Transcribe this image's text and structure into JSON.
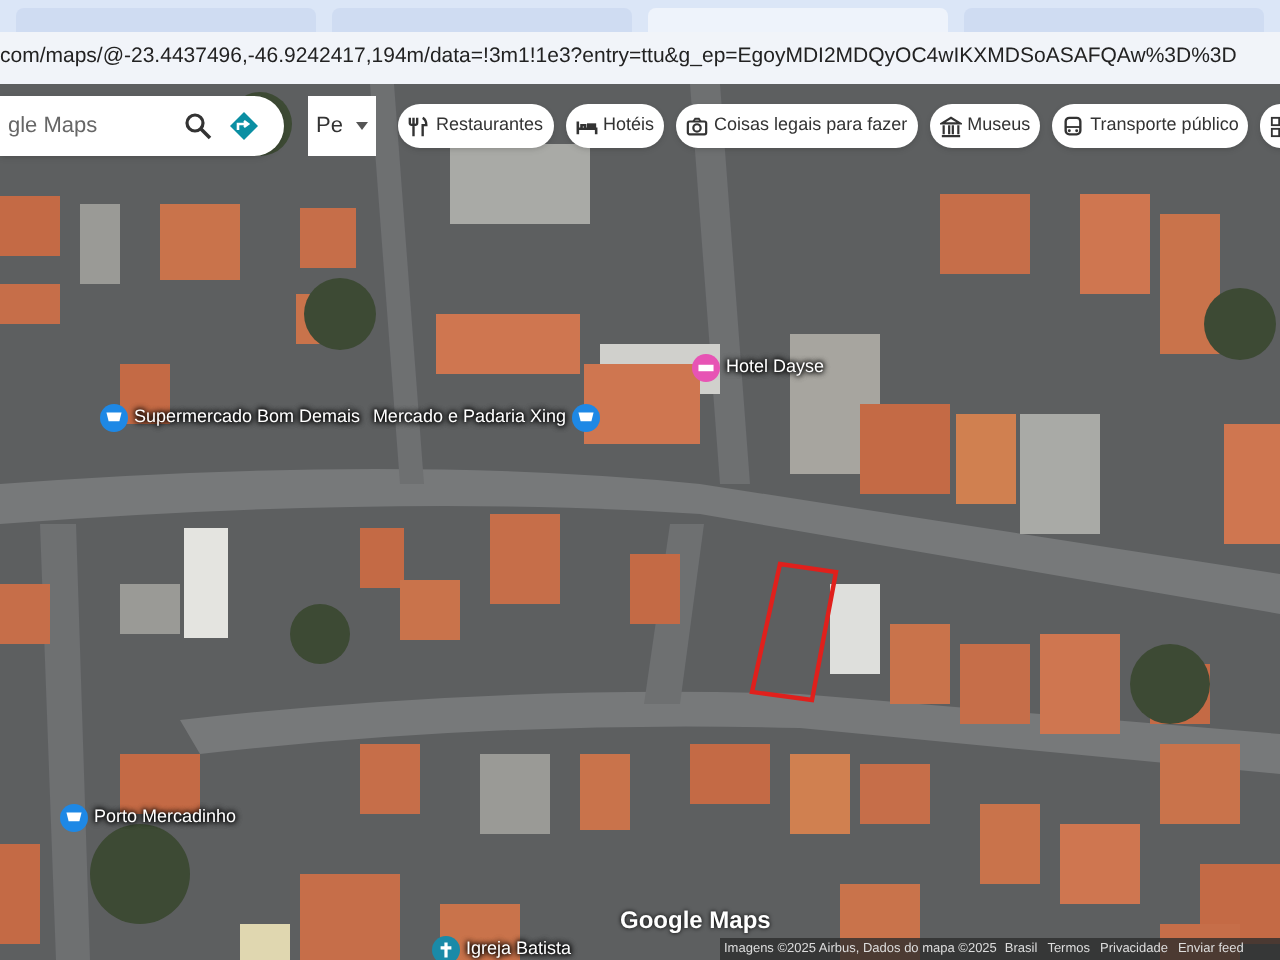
{
  "browser": {
    "tabs": [
      {
        "selected": false
      },
      {
        "selected": false
      },
      {
        "selected": true
      },
      {
        "selected": false
      }
    ],
    "url": "com/maps/@-23.4437496,-46.9242417,194m/data=!3m1!1e3?entry=ttu&g_ep=EgoyMDI2MDQyOC4wIKXMDSoASAFQAw%3D%3D"
  },
  "search": {
    "placeholder": "gle Maps"
  },
  "layer_menu": {
    "label": "Pe"
  },
  "chips": [
    {
      "label": "Restaurantes",
      "kind": "fork"
    },
    {
      "label": "Hotéis",
      "kind": "bed"
    },
    {
      "label": "Coisas legais para fazer",
      "kind": "camera"
    },
    {
      "label": "Museus",
      "kind": "museum"
    },
    {
      "label": "Transporte público",
      "kind": "bus"
    },
    {
      "kind": "more"
    }
  ],
  "places": [
    {
      "label": "Supermercado Bom Demais",
      "kind": "shop",
      "color": "#1e88e5"
    },
    {
      "label": "Mercado e Padaria Xing",
      "kind": "shop",
      "color": "#1e88e5"
    },
    {
      "label": "Hotel Dayse",
      "kind": "hotel",
      "color": "#e754b4"
    },
    {
      "label": "Porto Mercadinho",
      "kind": "shop",
      "color": "#1e88e5"
    },
    {
      "label": "Igreja Batista",
      "kind": "church",
      "color": "#1a8aa8"
    }
  ],
  "map": {
    "logo": "Google Maps",
    "attribution": "Imagens ©2025 Airbus, Dados do mapa ©2025",
    "links": [
      "Brasil",
      "Termos",
      "Privacidade",
      "Enviar feed"
    ]
  }
}
